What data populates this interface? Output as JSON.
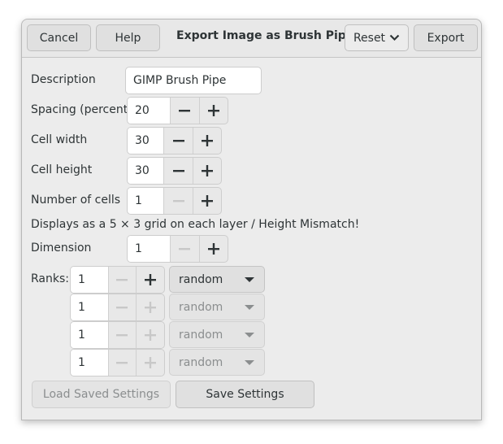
{
  "header": {
    "title": "Export Image as Brush Pipe",
    "cancel_label": "Cancel",
    "help_label": "Help",
    "reset_label": "Reset",
    "export_label": "Export"
  },
  "form": {
    "description": {
      "label": "Description",
      "value": "GIMP Brush Pipe"
    },
    "spacing": {
      "label": "Spacing (percent)",
      "value": "20"
    },
    "cell_width": {
      "label": "Cell width",
      "value": "30"
    },
    "cell_height": {
      "label": "Cell height",
      "value": "30"
    },
    "num_cells": {
      "label": "Number of cells",
      "value": "1"
    },
    "info_text": "Displays as a 5 × 3 grid on each layer / Height Mismatch!",
    "dimension": {
      "label": "Dimension",
      "value": "1"
    },
    "ranks_label": "Ranks:",
    "ranks": [
      {
        "value": "1",
        "selection": "random",
        "enabled": true
      },
      {
        "value": "1",
        "selection": "random",
        "enabled": false
      },
      {
        "value": "1",
        "selection": "random",
        "enabled": false
      },
      {
        "value": "1",
        "selection": "random",
        "enabled": false
      }
    ]
  },
  "footer": {
    "load_label": "Load Saved Settings",
    "save_label": "Save Settings"
  },
  "colors": {
    "text": "#2e3436",
    "disabled_text": "#8b8e8f",
    "dialog_bg": "#ececec"
  }
}
